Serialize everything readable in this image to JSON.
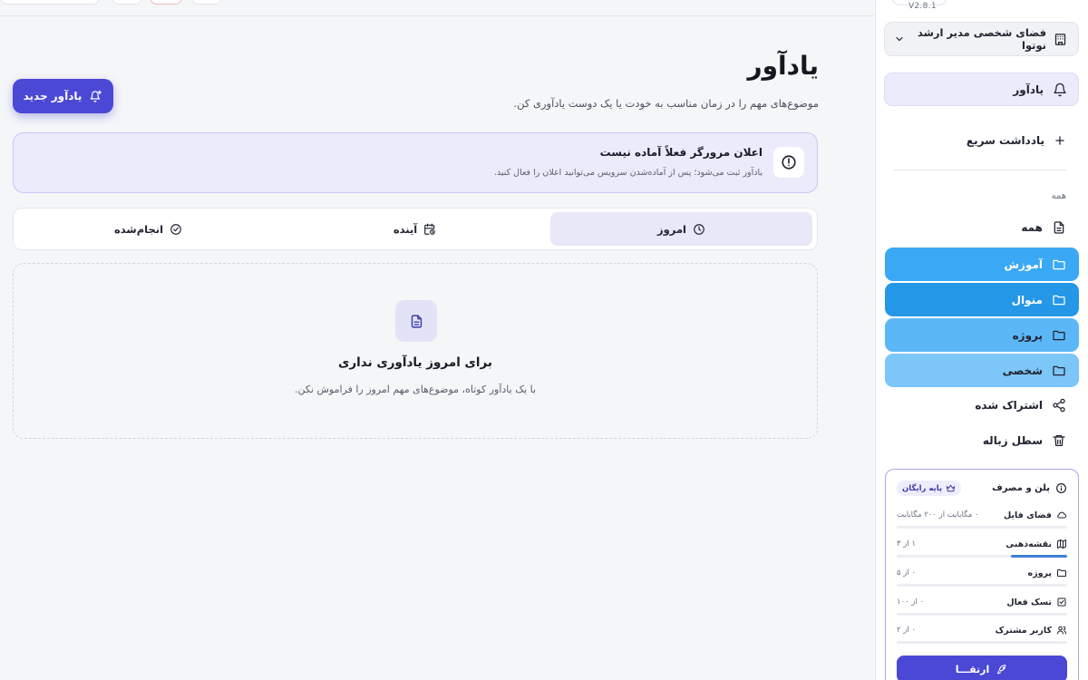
{
  "app": {
    "version": "V2.8.1"
  },
  "workspace": {
    "label": "فضای شخصی مدیر ارشد نوتوا"
  },
  "sidebar": {
    "reminder_label": "یادآور",
    "quick_note_label": "یادداشت سریع",
    "section_title": "همه",
    "items": [
      {
        "label": "همه",
        "icon": "document-icon"
      },
      {
        "label": "آموزش",
        "icon": "folder-icon",
        "color": "#3aa8f5"
      },
      {
        "label": "منوال",
        "icon": "folder-icon",
        "color": "#2497e6"
      },
      {
        "label": "پروژه",
        "icon": "folder-icon",
        "color": "#5cb7f7"
      },
      {
        "label": "شخصی",
        "icon": "folder-icon",
        "color": "#7cc6f8"
      },
      {
        "label": "اشتراک شده",
        "icon": "share-icon"
      },
      {
        "label": "سطل زباله",
        "icon": "trash-icon"
      }
    ]
  },
  "plan": {
    "title": "پلن و مصرف",
    "badge": "پایه رایگان",
    "usage": [
      {
        "name": "فضای فایل",
        "value": "۰ مگابایت از ۲۰۰ مگابایت",
        "fraction": 0,
        "icon": "cloud-icon"
      },
      {
        "name": "نقشه‌ذهنی",
        "value": "۱ از ۳",
        "fraction": 0.33,
        "icon": "map-icon"
      },
      {
        "name": "پروژه",
        "value": "۰ از ۵",
        "fraction": 0,
        "icon": "folder-icon"
      },
      {
        "name": "تسک فعال",
        "value": "۰ از ۱۰۰",
        "fraction": 0,
        "icon": "checkbox-icon"
      },
      {
        "name": "کاربر مشترک",
        "value": "۰ از ۲",
        "fraction": 0,
        "icon": "users-icon"
      }
    ],
    "upgrade_label": "ارتقـــا"
  },
  "main": {
    "title": "یادآور",
    "subtitle": "موضوع‌های مهم را در زمان مناسب به خودت یا یک دوست یادآوری کن.",
    "new_button": "یادآور جدید",
    "notice": {
      "title": "اعلان مرورگر فعلاً آماده نیست",
      "body": "یادآور ثبت می‌شود؛ پس از آماده‌شدن سرویس می‌توانید اعلان را فعال کنید."
    },
    "tabs": [
      {
        "label": "امروز",
        "active": true
      },
      {
        "label": "آینده",
        "active": false
      },
      {
        "label": "انجام‌شده",
        "active": false
      }
    ],
    "empty": {
      "title": "برای امروز یادآوری نداری",
      "body": "با یک یادآور کوتاه، موضوع‌های مهم امروز را فراموش نکن."
    }
  },
  "colors": {
    "accent": "#4b48d6",
    "accent_soft": "#ebebfb"
  }
}
